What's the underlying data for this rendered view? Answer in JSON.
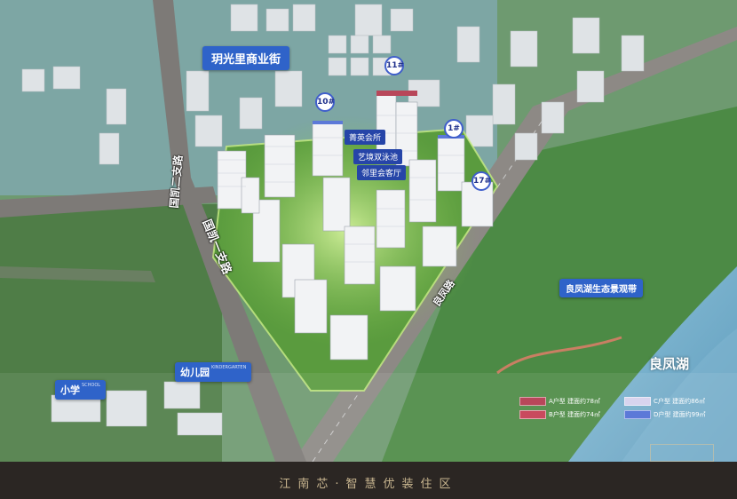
{
  "map": {
    "title_tag": "玥光里商业街",
    "pins": [
      "10#",
      "11#",
      "1#",
      "17#"
    ],
    "amenities": [
      "菁英会所",
      "艺境双泳池",
      "邻里会客厅"
    ],
    "roads": [
      "国凯二支路",
      "国凯一支路",
      "良凤路"
    ],
    "schools": [
      {
        "label": "小学",
        "en": "SCHOOL"
      },
      {
        "label": "幼儿园",
        "en": "KINDERGARTEN"
      }
    ],
    "eco_band_label": "良凤湖生态景观带",
    "lake_label": "良凤湖",
    "legend": [
      {
        "text": "A户型 建面约78㎡",
        "color": "#b8475a"
      },
      {
        "text": "B户型 建面约74㎡",
        "color": "#c94a5e"
      },
      {
        "text": "C户型 建面约86㎡",
        "color": "#d8d4ee"
      },
      {
        "text": "D户型 建面约99㎡",
        "color": "#5c79d8"
      }
    ]
  },
  "footer": {
    "slogan": "江南芯·智慧优装住区"
  }
}
